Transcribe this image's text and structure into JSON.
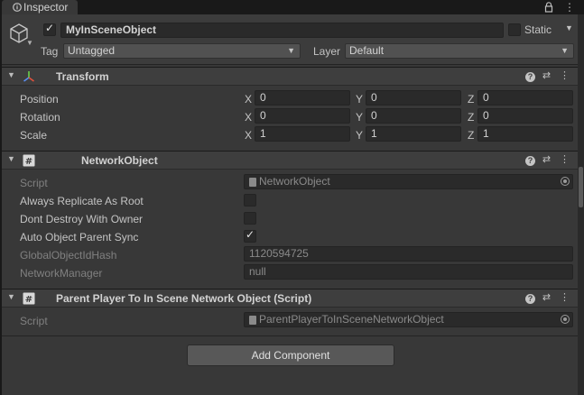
{
  "window": {
    "tab_title": "Inspector",
    "tab_icon": "info-icon",
    "menu_icon": "kebab-menu-icon",
    "lock_icon": "lock-icon"
  },
  "gameobject": {
    "active": true,
    "name": "MyInSceneObject",
    "static_label": "Static",
    "static": false,
    "tag_label": "Tag",
    "tag_value": "Untagged",
    "layer_label": "Layer",
    "layer_value": "Default"
  },
  "transform": {
    "title": "Transform",
    "rows": [
      {
        "label": "Position",
        "x": "0",
        "y": "0",
        "z": "0"
      },
      {
        "label": "Rotation",
        "x": "0",
        "y": "0",
        "z": "0"
      },
      {
        "label": "Scale",
        "x": "1",
        "y": "1",
        "z": "1"
      }
    ],
    "axes": [
      "X",
      "Y",
      "Z"
    ]
  },
  "network_object": {
    "title": "NetworkObject",
    "script_label": "Script",
    "script_value": "NetworkObject",
    "always_replicate_label": "Always Replicate As Root",
    "always_replicate": false,
    "dont_destroy_label": "Dont Destroy With Owner",
    "dont_destroy": false,
    "auto_parent_label": "Auto Object Parent Sync",
    "auto_parent": true,
    "global_hash_label": "GlobalObjectIdHash",
    "global_hash_value": "1120594725",
    "network_manager_label": "NetworkManager",
    "network_manager_value": "null"
  },
  "parent_player": {
    "title": "Parent Player To In Scene Network Object (Script)",
    "script_label": "Script",
    "script_value": "ParentPlayerToInSceneNetworkObject"
  },
  "header_icons": {
    "help": "?",
    "presets": "⇄",
    "more": "⋮"
  },
  "checkmark": "✓",
  "add_component_label": "Add Component",
  "colors": {
    "panel": "#383838",
    "header": "#3e3e3e",
    "field": "#2a2a2a",
    "button": "#585858"
  }
}
